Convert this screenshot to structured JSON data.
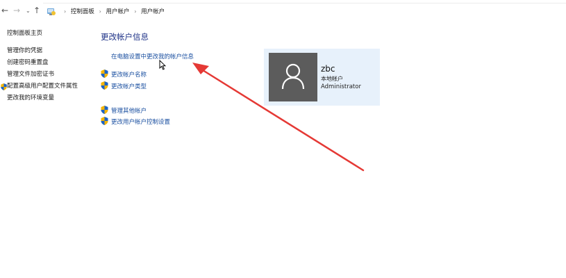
{
  "address_bar": {
    "back_icon": "back-arrow-icon",
    "forward_icon": "forward-arrow-icon",
    "history_icon": "chevron-down-icon",
    "up_icon": "up-arrow-icon",
    "location_icon": "control-panel-icon",
    "breadcrumbs": [
      "控制面板",
      "用户帐户",
      "用户帐户"
    ]
  },
  "sidebar": {
    "home": "控制面板主页",
    "items": [
      "管理你的凭据",
      "创建密码重置盘",
      "管理文件加密证书",
      "配置高级用户配置文件属性",
      "更改我的环境变量"
    ]
  },
  "main": {
    "title": "更改帐户信息",
    "pc_settings_link": "在电脑设置中更改我的帐户信息",
    "change_name": "更改帐户名称",
    "change_type": "更改帐户类型",
    "manage_other": "管理其他帐户",
    "uac_settings": "更改用户帐户控制设置"
  },
  "account": {
    "name": "zbc",
    "type": "本地帐户",
    "role": "Administrator"
  },
  "colors": {
    "link": "#1a4fa0",
    "title": "#1e3287",
    "card_bg": "#e7f1fb",
    "avatar_bg": "#5c5c5c",
    "annotation_arrow": "#e53935"
  }
}
